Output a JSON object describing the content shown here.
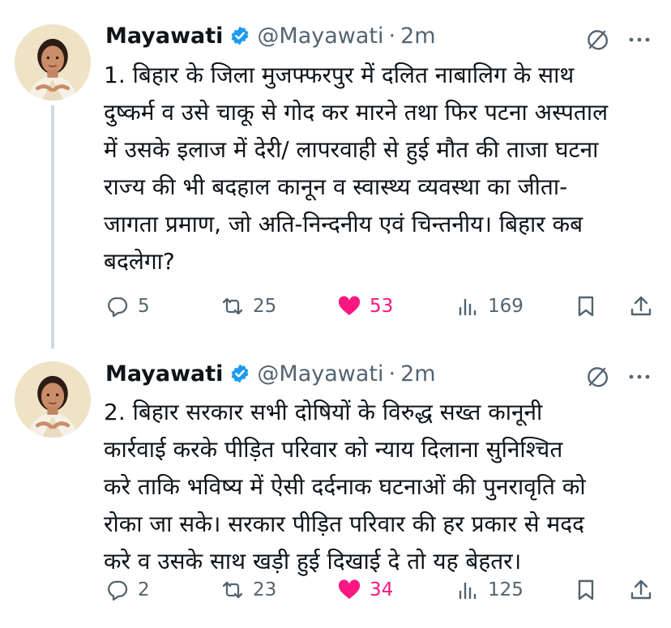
{
  "colors": {
    "text": "#0f1419",
    "muted": "#536471",
    "verified": "#1d9bf0",
    "like": "#f91880",
    "thread_line": "#cfd9de"
  },
  "tweets": [
    {
      "author": {
        "name": "Mayawati",
        "handle": "@Mayawati",
        "separator": "·",
        "time": "2m",
        "verified_icon": "verified-badge-icon"
      },
      "text_lines": [
        "1. बिहार के जिला मुजफ्फरपुर में दलित नाबालिग के साथ",
        "दुष्कर्म व उसे चाकू से गोद कर मारने तथा फिर पटना अस्पताल",
        "में उसके इलाज में देरी/ लापरवाही से हुई मौत की ताजा घटना",
        "राज्य की भी बदहाल कानून व स्वास्थ्य व्यवस्था का जीता-",
        "जागता प्रमाण, जो अति-निन्दनीय एवं चिन्तनीय। बिहार कब",
        "बदलेगा?"
      ],
      "actions": {
        "replies": "5",
        "retweets": "25",
        "likes": "53",
        "views": "169"
      }
    },
    {
      "author": {
        "name": "Mayawati",
        "handle": "@Mayawati",
        "separator": "·",
        "time": "2m",
        "verified_icon": "verified-badge-icon"
      },
      "text_lines": [
        "2. बिहार सरकार सभी दोषियों के विरुद्ध सख्त कानूनी",
        "कार्रवाई करके पीड़ित परिवार को न्याय दिलाना सुनिश्चित",
        "करे ताकि भविष्य में ऐसी दर्दनाक घटनाओं की पुनरावृति को",
        "रोका जा सके। सरकार पीड़ित परिवार की हर प्रकार से मदद",
        "करे व उसके साथ खड़ी हुई दिखाई दे तो यह बेहतर।"
      ],
      "actions": {
        "replies": "2",
        "retweets": "23",
        "likes": "34",
        "views": "125"
      }
    }
  ]
}
